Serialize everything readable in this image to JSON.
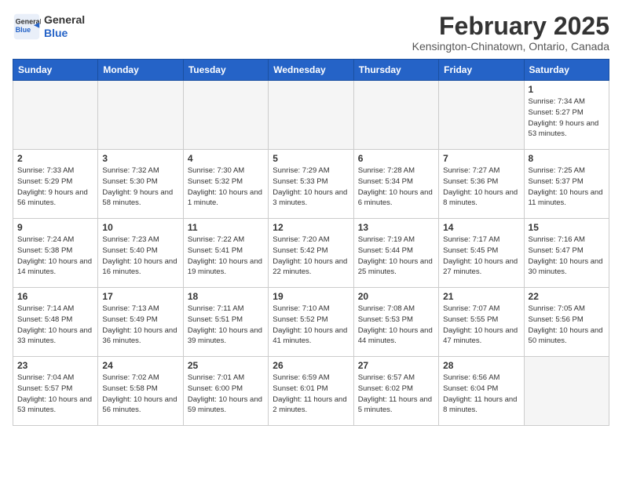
{
  "header": {
    "logo_line1": "General",
    "logo_line2": "Blue",
    "month_title": "February 2025",
    "subtitle": "Kensington-Chinatown, Ontario, Canada"
  },
  "weekdays": [
    "Sunday",
    "Monday",
    "Tuesday",
    "Wednesday",
    "Thursday",
    "Friday",
    "Saturday"
  ],
  "weeks": [
    [
      {
        "day": "",
        "info": ""
      },
      {
        "day": "",
        "info": ""
      },
      {
        "day": "",
        "info": ""
      },
      {
        "day": "",
        "info": ""
      },
      {
        "day": "",
        "info": ""
      },
      {
        "day": "",
        "info": ""
      },
      {
        "day": "1",
        "info": "Sunrise: 7:34 AM\nSunset: 5:27 PM\nDaylight: 9 hours and 53 minutes."
      }
    ],
    [
      {
        "day": "2",
        "info": "Sunrise: 7:33 AM\nSunset: 5:29 PM\nDaylight: 9 hours and 56 minutes."
      },
      {
        "day": "3",
        "info": "Sunrise: 7:32 AM\nSunset: 5:30 PM\nDaylight: 9 hours and 58 minutes."
      },
      {
        "day": "4",
        "info": "Sunrise: 7:30 AM\nSunset: 5:32 PM\nDaylight: 10 hours and 1 minute."
      },
      {
        "day": "5",
        "info": "Sunrise: 7:29 AM\nSunset: 5:33 PM\nDaylight: 10 hours and 3 minutes."
      },
      {
        "day": "6",
        "info": "Sunrise: 7:28 AM\nSunset: 5:34 PM\nDaylight: 10 hours and 6 minutes."
      },
      {
        "day": "7",
        "info": "Sunrise: 7:27 AM\nSunset: 5:36 PM\nDaylight: 10 hours and 8 minutes."
      },
      {
        "day": "8",
        "info": "Sunrise: 7:25 AM\nSunset: 5:37 PM\nDaylight: 10 hours and 11 minutes."
      }
    ],
    [
      {
        "day": "9",
        "info": "Sunrise: 7:24 AM\nSunset: 5:38 PM\nDaylight: 10 hours and 14 minutes."
      },
      {
        "day": "10",
        "info": "Sunrise: 7:23 AM\nSunset: 5:40 PM\nDaylight: 10 hours and 16 minutes."
      },
      {
        "day": "11",
        "info": "Sunrise: 7:22 AM\nSunset: 5:41 PM\nDaylight: 10 hours and 19 minutes."
      },
      {
        "day": "12",
        "info": "Sunrise: 7:20 AM\nSunset: 5:42 PM\nDaylight: 10 hours and 22 minutes."
      },
      {
        "day": "13",
        "info": "Sunrise: 7:19 AM\nSunset: 5:44 PM\nDaylight: 10 hours and 25 minutes."
      },
      {
        "day": "14",
        "info": "Sunrise: 7:17 AM\nSunset: 5:45 PM\nDaylight: 10 hours and 27 minutes."
      },
      {
        "day": "15",
        "info": "Sunrise: 7:16 AM\nSunset: 5:47 PM\nDaylight: 10 hours and 30 minutes."
      }
    ],
    [
      {
        "day": "16",
        "info": "Sunrise: 7:14 AM\nSunset: 5:48 PM\nDaylight: 10 hours and 33 minutes."
      },
      {
        "day": "17",
        "info": "Sunrise: 7:13 AM\nSunset: 5:49 PM\nDaylight: 10 hours and 36 minutes."
      },
      {
        "day": "18",
        "info": "Sunrise: 7:11 AM\nSunset: 5:51 PM\nDaylight: 10 hours and 39 minutes."
      },
      {
        "day": "19",
        "info": "Sunrise: 7:10 AM\nSunset: 5:52 PM\nDaylight: 10 hours and 41 minutes."
      },
      {
        "day": "20",
        "info": "Sunrise: 7:08 AM\nSunset: 5:53 PM\nDaylight: 10 hours and 44 minutes."
      },
      {
        "day": "21",
        "info": "Sunrise: 7:07 AM\nSunset: 5:55 PM\nDaylight: 10 hours and 47 minutes."
      },
      {
        "day": "22",
        "info": "Sunrise: 7:05 AM\nSunset: 5:56 PM\nDaylight: 10 hours and 50 minutes."
      }
    ],
    [
      {
        "day": "23",
        "info": "Sunrise: 7:04 AM\nSunset: 5:57 PM\nDaylight: 10 hours and 53 minutes."
      },
      {
        "day": "24",
        "info": "Sunrise: 7:02 AM\nSunset: 5:58 PM\nDaylight: 10 hours and 56 minutes."
      },
      {
        "day": "25",
        "info": "Sunrise: 7:01 AM\nSunset: 6:00 PM\nDaylight: 10 hours and 59 minutes."
      },
      {
        "day": "26",
        "info": "Sunrise: 6:59 AM\nSunset: 6:01 PM\nDaylight: 11 hours and 2 minutes."
      },
      {
        "day": "27",
        "info": "Sunrise: 6:57 AM\nSunset: 6:02 PM\nDaylight: 11 hours and 5 minutes."
      },
      {
        "day": "28",
        "info": "Sunrise: 6:56 AM\nSunset: 6:04 PM\nDaylight: 11 hours and 8 minutes."
      },
      {
        "day": "",
        "info": ""
      }
    ]
  ]
}
